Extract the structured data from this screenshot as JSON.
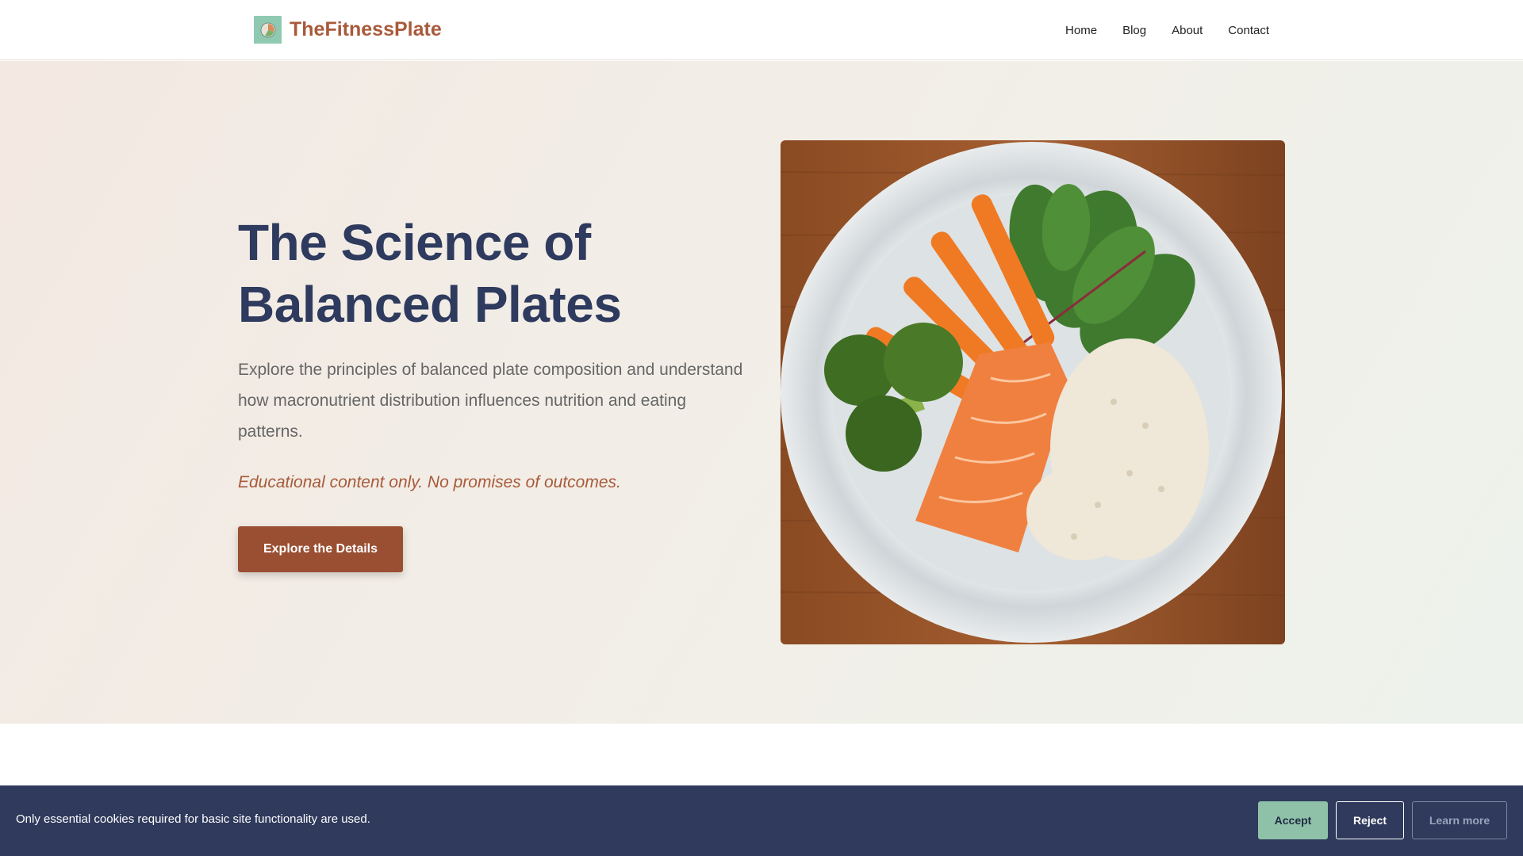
{
  "brand": {
    "name": "TheFitnessPlate",
    "logo_icon": "plate-logo-icon",
    "color": "#a85a3a"
  },
  "nav": {
    "items": [
      "Home",
      "Blog",
      "About",
      "Contact"
    ]
  },
  "hero": {
    "title_line1": "The Science of",
    "title_line2": "Balanced Plates",
    "description": "Explore the principles of balanced plate composition and understand how macronutrient distribution influences nutrition and eating patterns.",
    "note": "Educational content only. No promises of outcomes.",
    "cta": "Explore the Details",
    "image_subject": "balanced-plate-photo"
  },
  "cookie": {
    "text": "Only essential cookies required for basic site functionality are used.",
    "accept": "Accept",
    "reject": "Reject",
    "learn_more": "Learn more"
  },
  "colors": {
    "title": "#2e3a5e",
    "accent": "#9a4f32",
    "cookie_bg": "#2f3a5c",
    "accept_bg": "#8fc1a8"
  }
}
